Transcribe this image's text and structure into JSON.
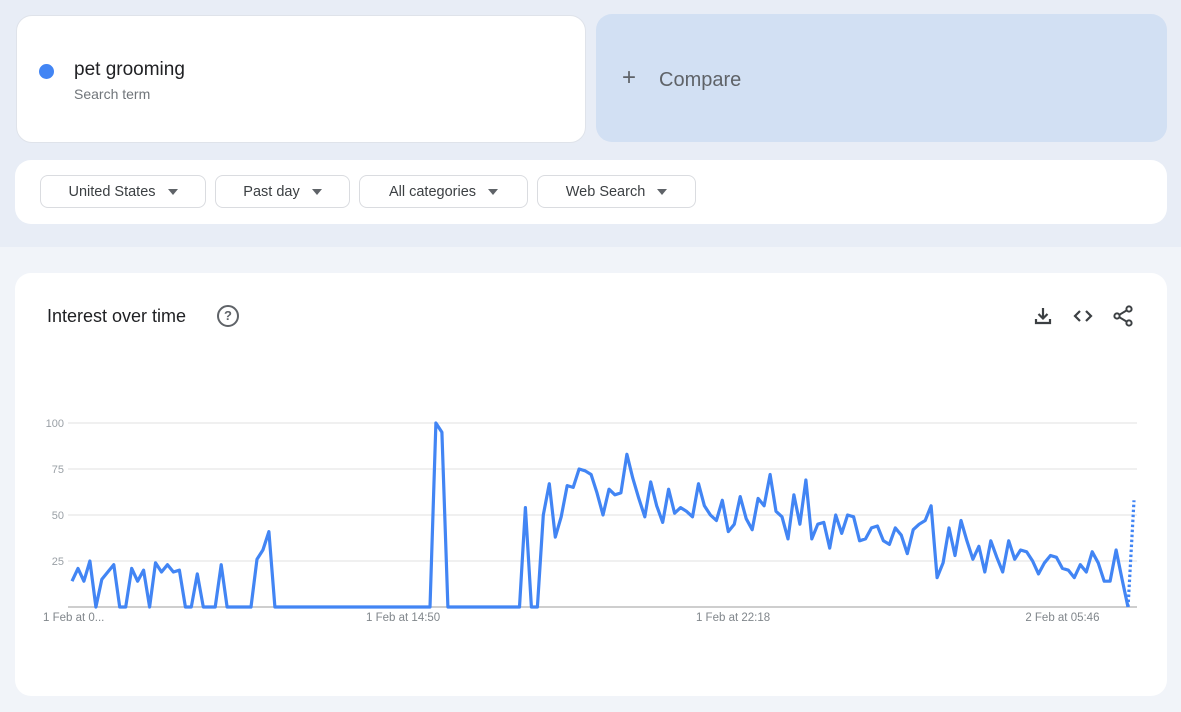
{
  "search_term": {
    "label": "pet grooming",
    "sublabel": "Search term",
    "color": "#4285f4"
  },
  "compare": {
    "icon": "plus-icon",
    "label": "Compare"
  },
  "filters": [
    {
      "label": "United States"
    },
    {
      "label": "Past day"
    },
    {
      "label": "All categories"
    },
    {
      "label": "Web Search"
    }
  ],
  "chart_section": {
    "title": "Interest over time",
    "help_icon": "help-circle-icon",
    "help_glyph": "?",
    "actions": [
      "download-icon",
      "embed-code-icon",
      "share-icon"
    ]
  },
  "chart_data": {
    "type": "line",
    "title": "",
    "ylim": [
      0,
      100
    ],
    "yticks": [
      "100",
      "75",
      "50",
      "25"
    ],
    "xtick_labels": [
      "1 Feb at 0...",
      "1 Feb at 14:50",
      "1 Feb at 22:18",
      "2 Feb at 05:46"
    ],
    "grid": true,
    "series_color": "#4285f4",
    "last_point_partial": true,
    "values": [
      14,
      21,
      14,
      25,
      0,
      15,
      19,
      23,
      0,
      0,
      21,
      14,
      20,
      0,
      24,
      19,
      23,
      19,
      20,
      0,
      0,
      18,
      0,
      0,
      0,
      23,
      0,
      0,
      0,
      0,
      0,
      26,
      31,
      41,
      0,
      0,
      0,
      0,
      0,
      0,
      0,
      0,
      0,
      0,
      0,
      0,
      0,
      0,
      0,
      0,
      0,
      0,
      0,
      0,
      0,
      0,
      0,
      0,
      0,
      0,
      0,
      100,
      95,
      0,
      0,
      0,
      0,
      0,
      0,
      0,
      0,
      0,
      0,
      0,
      0,
      0,
      54,
      0,
      0,
      50,
      67,
      38,
      49,
      66,
      65,
      75,
      74,
      72,
      62,
      50,
      64,
      61,
      62,
      83,
      70,
      59,
      49,
      68,
      55,
      46,
      64,
      51,
      54,
      52,
      49,
      67,
      55,
      50,
      47,
      58,
      41,
      45,
      60,
      48,
      42,
      59,
      55,
      72,
      52,
      49,
      37,
      61,
      45,
      69,
      37,
      45,
      46,
      32,
      50,
      40,
      50,
      49,
      36,
      37,
      43,
      44,
      36,
      34,
      43,
      39,
      29,
      42,
      45,
      47,
      55,
      16,
      24,
      43,
      28,
      47,
      36,
      26,
      33,
      19,
      36,
      27,
      19,
      36,
      26,
      31,
      30,
      25,
      18,
      24,
      28,
      27,
      21,
      20,
      16,
      23,
      19,
      30,
      24,
      14,
      14,
      31,
      15,
      0,
      58
    ]
  }
}
